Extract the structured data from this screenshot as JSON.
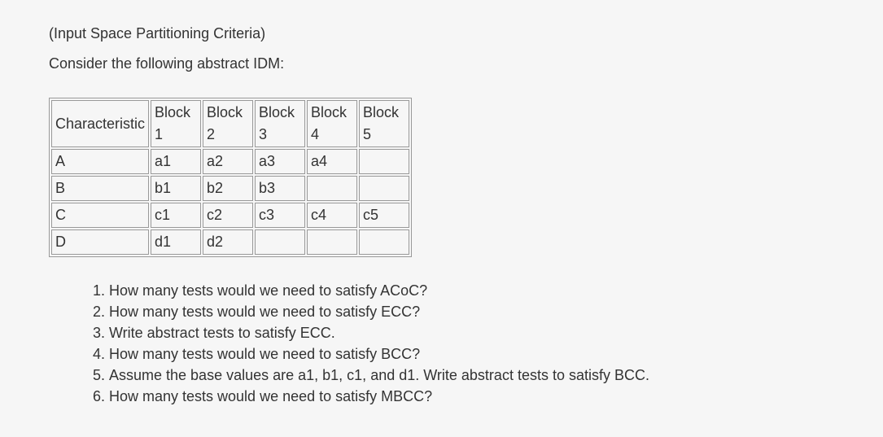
{
  "intro": {
    "line1": "(Input Space Partitioning Criteria)",
    "line2": "Consider the following abstract IDM:"
  },
  "table": {
    "headers": [
      "Characteristic",
      "Block 1",
      "Block 2",
      "Block 3",
      "Block 4",
      "Block 5"
    ],
    "rows": [
      {
        "char": "A",
        "b1": "a1",
        "b2": "a2",
        "b3": "a3",
        "b4": "a4",
        "b5": ""
      },
      {
        "char": "B",
        "b1": "b1",
        "b2": "b2",
        "b3": "b3",
        "b4": "",
        "b5": ""
      },
      {
        "char": "C",
        "b1": "c1",
        "b2": "c2",
        "b3": "c3",
        "b4": "c4",
        "b5": "c5"
      },
      {
        "char": "D",
        "b1": "d1",
        "b2": "d2",
        "b3": "",
        "b4": "",
        "b5": ""
      }
    ]
  },
  "questions": [
    "How many tests would we need to satisfy ACoC?",
    "How many tests would we need to satisfy ECC?",
    "Write abstract tests to satisfy ECC.",
    "How many tests would we need to satisfy BCC?",
    "Assume the base values are a1, b1, c1, and d1. Write abstract tests to satisfy BCC.",
    "How many tests would we need to satisfy MBCC?"
  ]
}
